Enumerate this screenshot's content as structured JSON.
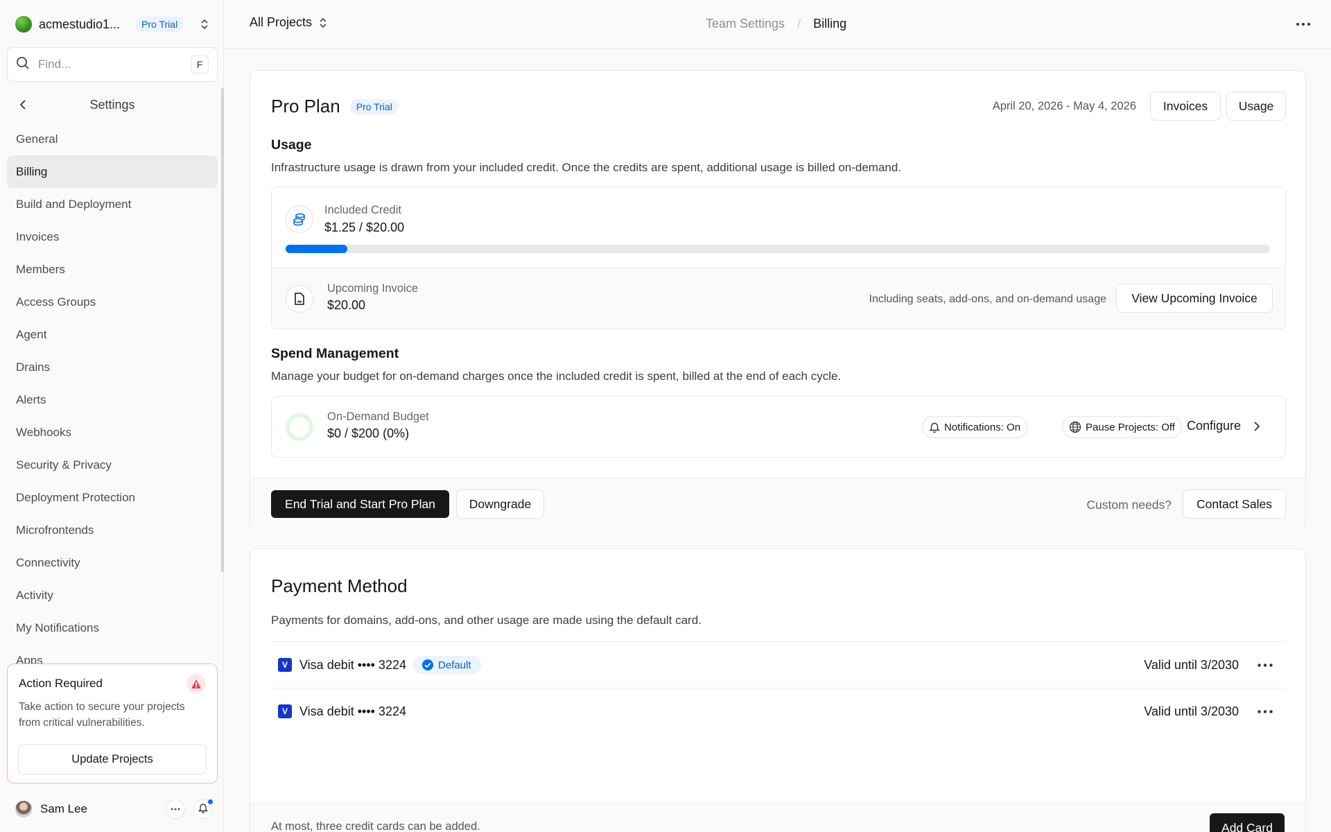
{
  "sidebar": {
    "team_name": "acmestudio1...",
    "team_badge": "Pro Trial",
    "search_placeholder": "Find...",
    "search_shortcut": "F",
    "settings_title": "Settings",
    "items": [
      {
        "label": "General"
      },
      {
        "label": "Billing",
        "active": true
      },
      {
        "label": "Build and Deployment"
      },
      {
        "label": "Invoices"
      },
      {
        "label": "Members"
      },
      {
        "label": "Access Groups"
      },
      {
        "label": "Agent"
      },
      {
        "label": "Drains"
      },
      {
        "label": "Alerts"
      },
      {
        "label": "Webhooks"
      },
      {
        "label": "Security & Privacy"
      },
      {
        "label": "Deployment Protection"
      },
      {
        "label": "Microfrontends"
      },
      {
        "label": "Connectivity"
      },
      {
        "label": "Activity"
      },
      {
        "label": "My Notifications"
      },
      {
        "label": "Apps"
      }
    ],
    "action": {
      "title": "Action Required",
      "text": "Take action to secure your projects from critical vulnerabilities.",
      "button": "Update Projects"
    },
    "user": {
      "name": "Sam Lee"
    }
  },
  "topbar": {
    "project_switch": "All Projects",
    "breadcrumb": [
      "Team Settings",
      "Billing"
    ]
  },
  "plan": {
    "title": "Pro Plan",
    "badge": "Pro Trial",
    "date_range": "April 20, 2026 - May 4, 2026",
    "invoices_button": "Invoices",
    "usage_button": "Usage",
    "usage": {
      "title": "Usage",
      "description": "Infrastructure usage is drawn from your included credit. Once the credits are spent, additional usage is billed on-demand.",
      "credit_label": "Included Credit",
      "credit_value": "$1.25 / $20.00",
      "credit_progress": 0.0625,
      "invoice_label": "Upcoming Invoice",
      "invoice_value": "$20.00",
      "invoice_note": "Including seats, add-ons, and on-demand usage",
      "view_invoice_button": "View Upcoming Invoice"
    },
    "spend": {
      "title": "Spend Management",
      "description": "Manage your budget for on-demand charges once the included credit is spent, billed at the end of each cycle.",
      "budget_label": "On-Demand Budget",
      "budget_value": "$0 / $200 (0%)",
      "notifications": "Notifications: On",
      "pause_projects": "Pause Projects: Off",
      "configure": "Configure"
    },
    "footer": {
      "end_trial_button": "End Trial and Start Pro Plan",
      "downgrade_button": "Downgrade",
      "custom_needs": "Custom needs?",
      "contact_button": "Contact Sales"
    }
  },
  "payment": {
    "title": "Payment Method",
    "description": "Payments for domains, add-ons, and other usage are made using the default card.",
    "cards": [
      {
        "brand_letter": "V",
        "label": "Visa debit •••• 3224",
        "default_badge": "Default",
        "valid": "Valid until 3/2030"
      },
      {
        "brand_letter": "V",
        "label": "Visa debit •••• 3224",
        "valid": "Valid until 3/2030"
      }
    ],
    "footer_note": "At most, three credit cards can be added.",
    "add_button": "Add Card"
  },
  "colors": {
    "accent": "#0070f3",
    "badge_bg": "#eaf3ff",
    "danger": "#e5484d",
    "visa": "#1434cb"
  },
  "icons": [
    "search-icon",
    "chevron-left-icon",
    "chevron-updown-icon",
    "warning-icon",
    "more-icon",
    "bell-icon",
    "coins-icon",
    "invoice-icon",
    "globe-icon",
    "chevron-right-icon",
    "check-circle-icon"
  ]
}
